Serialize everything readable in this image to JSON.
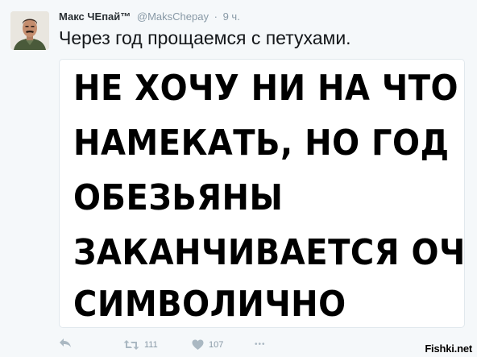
{
  "tweet": {
    "author_name": "Макс ЧЕпай™",
    "handle": "@MaksChepay",
    "separator": "·",
    "time": "9 ч.",
    "text": "Через год прощаемся с петухами."
  },
  "media": {
    "lines": [
      "НЕ ХОЧУ НИ НА ЧТО",
      "НАМЕКАТЬ, НО ГОД",
      "ОБЕЗЬЯНЫ",
      "ЗАКАНЧИВАЕТСЯ ОЧЕНЬ",
      "СИМВОЛИЧНО"
    ]
  },
  "actions": {
    "reply_icon": "reply-icon",
    "retweet_icon": "retweet-icon",
    "retweet_count": "111",
    "like_icon": "heart-icon",
    "like_count": "107",
    "more_icon": "more-icon",
    "more_label": "•••"
  },
  "watermark": "Fishki.net"
}
